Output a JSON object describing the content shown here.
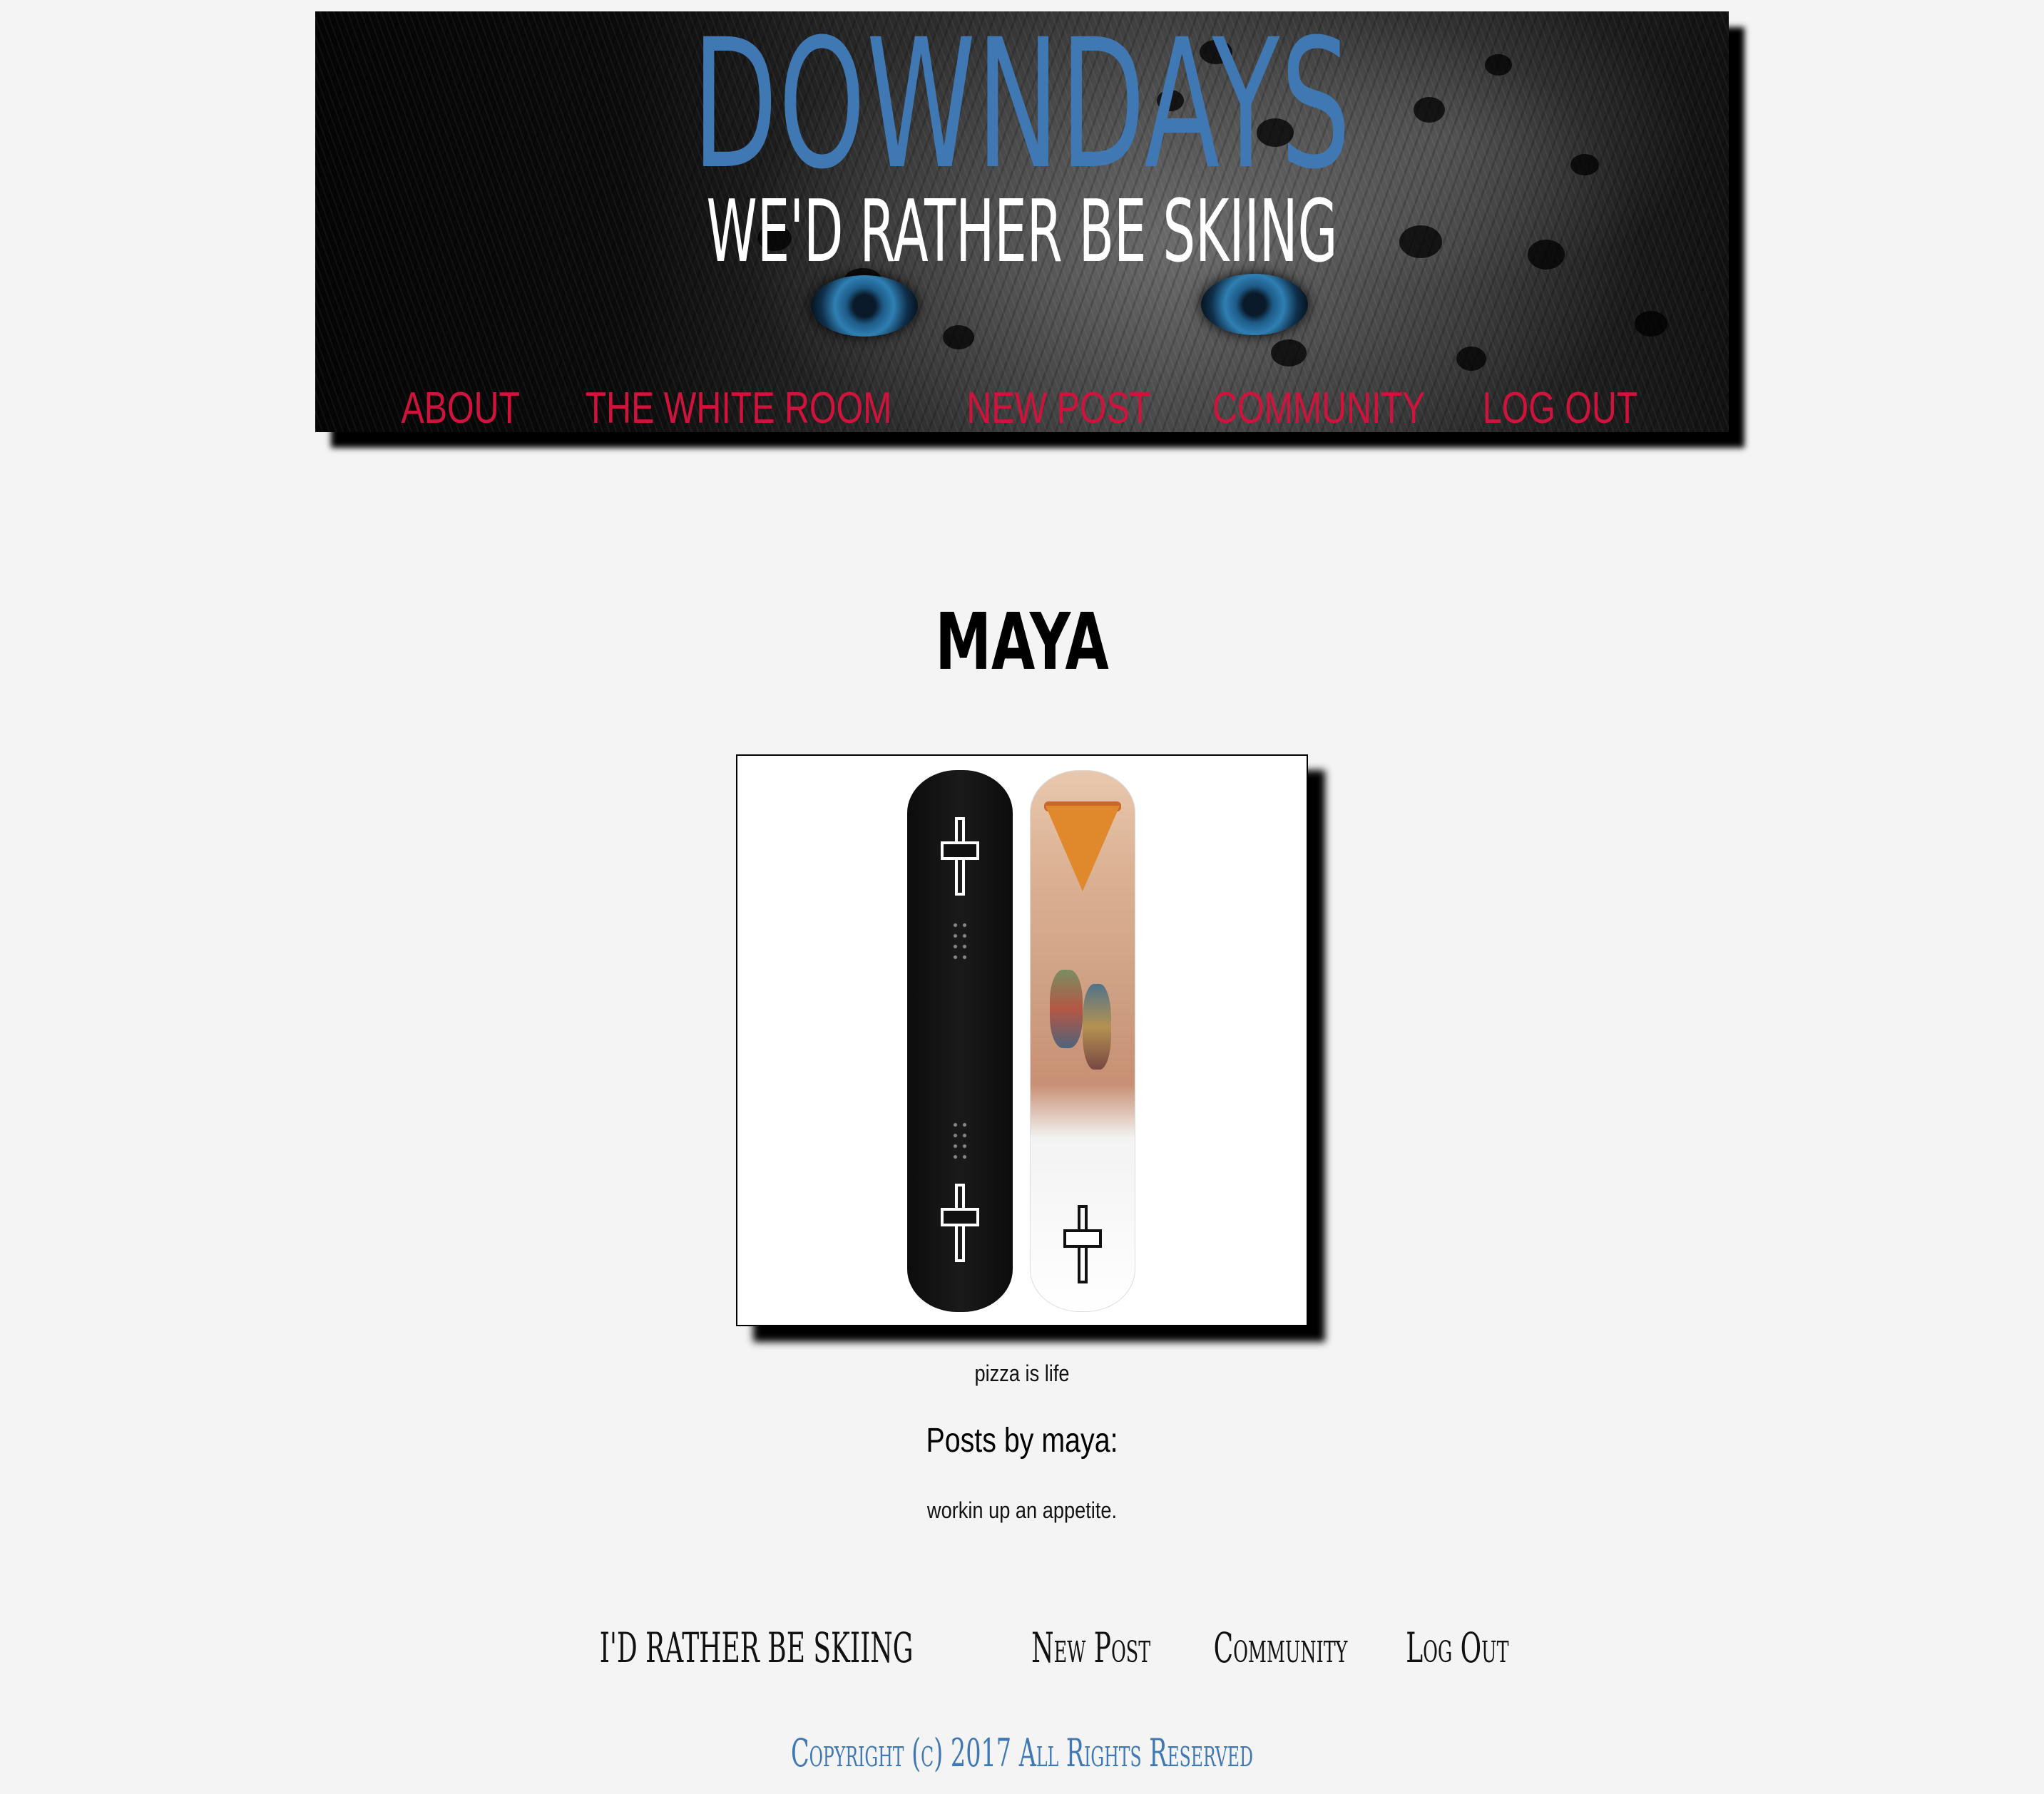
{
  "header": {
    "site_title": "DOWNDAYS",
    "tagline": "WE'D RATHER BE SKIING",
    "nav": [
      {
        "label": "ABOUT"
      },
      {
        "label": "THE WHITE ROOM"
      },
      {
        "label": "NEW POST"
      },
      {
        "label": "COMMUNITY"
      },
      {
        "label": "LOG OUT"
      }
    ],
    "nav_color": "#d0133c",
    "title_color": "#3f78b2"
  },
  "profile": {
    "username": "maya",
    "photo_caption": "pizza is life",
    "posts_heading": "Posts by maya:",
    "posts": [
      {
        "title": "workin up an appetite."
      }
    ]
  },
  "footer": {
    "nav": [
      {
        "label": "I'D RATHER BE SKIING"
      },
      {
        "label": "New Post"
      },
      {
        "label": "Community"
      },
      {
        "label": "Log Out"
      }
    ],
    "copyright": "Copyright (c) 2017 All Rights Reserved",
    "copyright_color": "#3f78b2"
  },
  "icons": {
    "banner_image": "snow-leopard-eyes-image",
    "profile_image": "snowboards-image"
  }
}
